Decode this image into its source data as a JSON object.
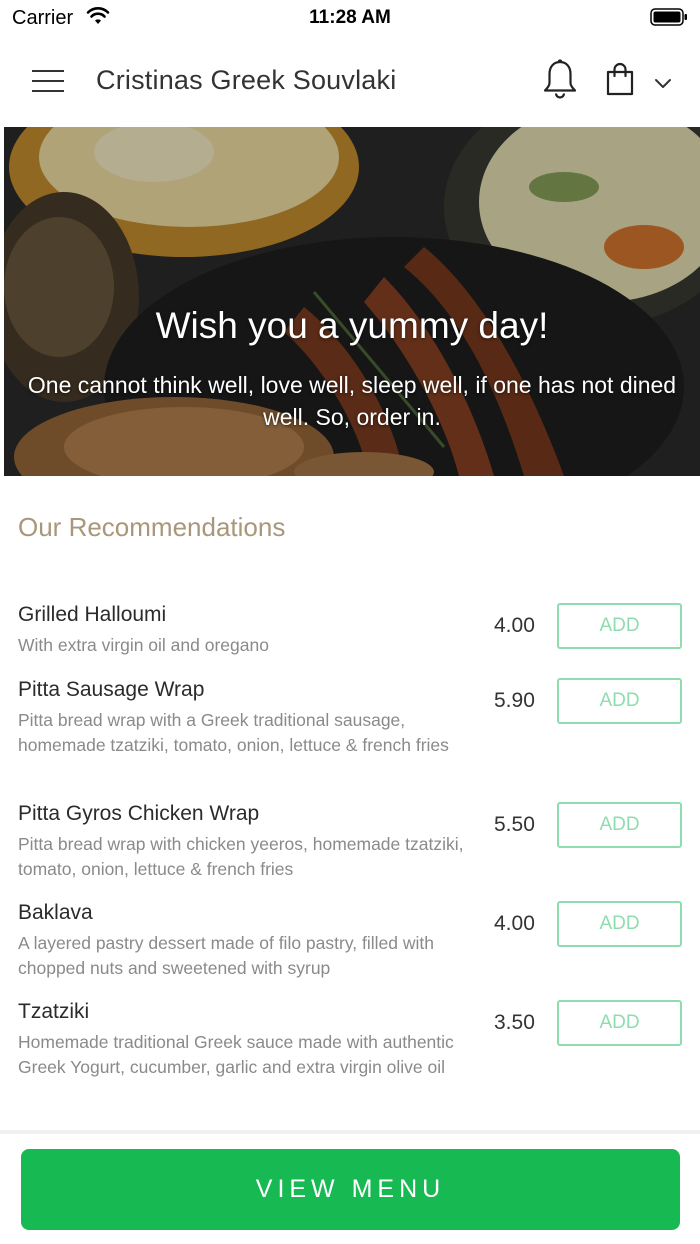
{
  "status_bar": {
    "carrier": "Carrier",
    "time": "11:28 AM"
  },
  "header": {
    "title": "Cristinas Greek Souvlaki",
    "icons": [
      "menu-icon",
      "bell-icon",
      "shopping-bag-icon",
      "chevron-down-icon"
    ]
  },
  "hero": {
    "title": "Wish you a yummy day!",
    "subtitle": "One cannot think well, love well, sleep well, if one has not dined well. So, order in."
  },
  "recommendations": {
    "title": "Our Recommendations",
    "items": [
      {
        "name": "Grilled Halloumi",
        "description": "With extra virgin oil and oregano",
        "price": "4.00",
        "add_label": "ADD"
      },
      {
        "name": "Pitta Sausage Wrap",
        "description": "Pitta bread wrap with a Greek traditional sausage, homemade tzatziki, tomato, onion, lettuce & french fries",
        "price": "5.90",
        "add_label": "ADD"
      },
      {
        "name": "Pitta Gyros Chicken Wrap",
        "description": "Pitta bread wrap with chicken yeeros, homemade tzatziki, tomato, onion, lettuce & french fries",
        "price": "5.50",
        "add_label": "ADD"
      },
      {
        "name": "Baklava",
        "description": "A layered pastry dessert made of filo pastry, filled with chopped nuts and sweetened with syrup",
        "price": "4.00",
        "add_label": "ADD"
      },
      {
        "name": "Tzatziki",
        "description": "Homemade traditional Greek sauce made with authentic Greek Yogurt, cucumber, garlic and extra virgin olive oil",
        "price": "3.50",
        "add_label": "ADD"
      }
    ]
  },
  "footer": {
    "view_menu_label": "VIEW MENU"
  },
  "colors": {
    "accent_green": "#17b953",
    "add_button_green": "#8fdcae",
    "section_title": "#a8977a"
  }
}
